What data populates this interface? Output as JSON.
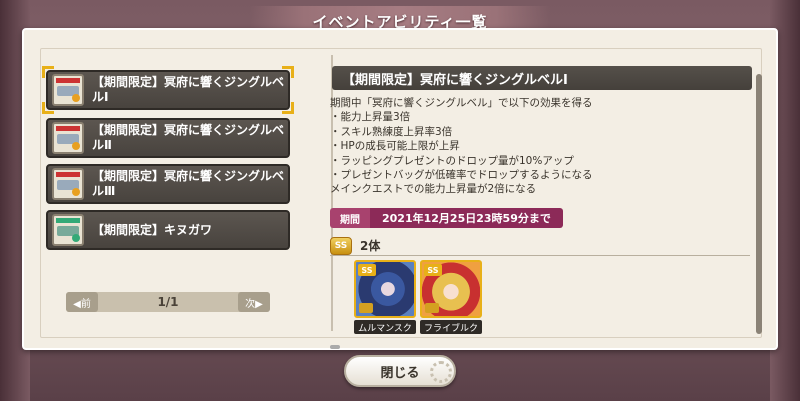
{
  "title": "イベントアビリティ一覧",
  "abilities": [
    {
      "label_line1": "【期間限定】冥府に響くジングルベ",
      "label_line2": "ルⅠ"
    },
    {
      "label_line1": "【期間限定】冥府に響くジングルベ",
      "label_line2": "ルⅡ"
    },
    {
      "label_line1": "【期間限定】冥府に響くジングルベ",
      "label_line2": "ルⅢ"
    },
    {
      "label_line1": "【期間限定】キヌガワ",
      "label_line2": ""
    }
  ],
  "pager": {
    "prev": "◀前",
    "page": "1/1",
    "next": "次▶"
  },
  "detail": {
    "title": "【期間限定】冥府に響くジングルベルⅠ",
    "lines": [
      "期間中「冥府に響くジングルベル」で以下の効果を得る",
      "・能力上昇量3倍",
      "・スキル熟練度上昇率3倍",
      "・HPの成長可能上限が上昇",
      "・ラッピングプレゼントのドロップ量が10%アップ",
      "・プレゼントバッグが低確率でドロップするようになる",
      "メインクエストでの能力上昇量が2倍になる"
    ],
    "period_tag": "期間",
    "period_value": "2021年12月25日23時59分まで",
    "rank_badge": "SS",
    "rank_count": "2体",
    "characters": [
      {
        "rank": "SS",
        "name": "ムルマンスク"
      },
      {
        "rank": "SS",
        "name": "フライブルク"
      }
    ]
  },
  "close_label": "閉じる",
  "colors": {
    "period_tag": "#a8426e",
    "period_value": "#8c2a58",
    "select_frame": "#e8b018"
  }
}
